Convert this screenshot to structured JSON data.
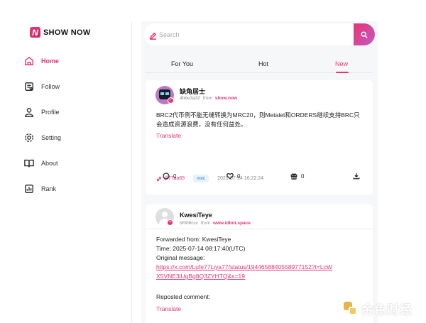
{
  "brand": {
    "name": "SHOW NOW",
    "mark": "N"
  },
  "nav": {
    "items": [
      {
        "label": "Home",
        "icon": "home-icon",
        "active": true
      },
      {
        "label": "Follow",
        "icon": "follow-icon",
        "active": false
      },
      {
        "label": "Profile",
        "icon": "profile-icon",
        "active": false
      },
      {
        "label": "Setting",
        "icon": "gear-icon",
        "active": false
      },
      {
        "label": "About",
        "icon": "book-icon",
        "active": false
      },
      {
        "label": "Rank",
        "icon": "chart-icon",
        "active": false
      }
    ]
  },
  "search": {
    "placeholder": "Search",
    "value": ""
  },
  "tabs": [
    {
      "label": "For You",
      "active": false
    },
    {
      "label": "Hot",
      "active": false
    },
    {
      "label": "New",
      "active": true
    }
  ],
  "posts": [
    {
      "username": "缺角居士",
      "user_id": "4bbe3a32",
      "from_label": "from",
      "source": "show.now",
      "content": "BRC2代币例不能无缝转换为MRC20，则Metalet和ORDERS继续支持BRC只会造成资源浪费，没有任何益处。",
      "translate_label": "Translate",
      "tx_hash": "df77aa65",
      "chain": "mvc",
      "timestamp": "2025-07-14 16:22:24",
      "comments": "0",
      "likes": "0",
      "gifts": "0"
    },
    {
      "username": "KwesiTeye",
      "user_id": "bf008ccc",
      "from_label": "from",
      "source": "www.idbot.space",
      "forwarded": "Forwarded from: KwesiTeye",
      "time_line": "Time: 2025-07-14 08:17:40(UTC)",
      "original_label": "Original message:",
      "original_link": "https://x.com/Lufe77Liya77/status/1944658840558977152?t=LcWX5VNE3iUgBg8Q3ZYHTQ&s=19",
      "reposted_label": "Reposted comment:",
      "translate_label": "Translate"
    }
  ],
  "watermark": {
    "text": "金色财经"
  },
  "colors": {
    "accent": "#e8346e",
    "chip_bg": "#e7f2fb",
    "chip_text": "#2b72b5"
  }
}
